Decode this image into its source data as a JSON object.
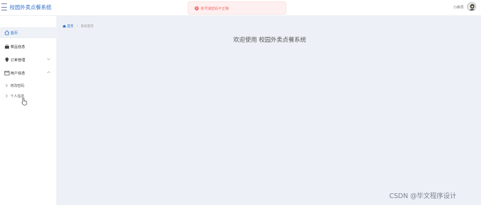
{
  "header": {
    "app_title": "校园外卖点餐系统",
    "user_name": "小麻烦"
  },
  "toast": {
    "message": "账号或密码不正确",
    "type": "error",
    "color": "#f56c6c"
  },
  "sidebar": {
    "items": [
      {
        "label": "首页",
        "icon": "home-icon",
        "active": true
      },
      {
        "label": "菜品信息",
        "icon": "briefcase-icon",
        "active": false
      },
      {
        "label": "订单管理",
        "icon": "location-pin-icon",
        "active": false,
        "expandable": true
      },
      {
        "label": "用户信息",
        "icon": "calendar-icon",
        "active": false,
        "expandable": true,
        "expanded": true
      }
    ],
    "sub_items": [
      {
        "label": "修改密码"
      },
      {
        "label": "个人信息"
      }
    ]
  },
  "main": {
    "breadcrumb": {
      "home": "首页",
      "current": "系统首页"
    },
    "welcome": "欢迎使用 校园外卖点餐系统"
  },
  "watermark": "CSDN @毕文程序设计",
  "colors": {
    "accent": "#2f6fcb",
    "main_bg": "#edf0f6",
    "sidebar_active_bg": "#eef1f6"
  }
}
